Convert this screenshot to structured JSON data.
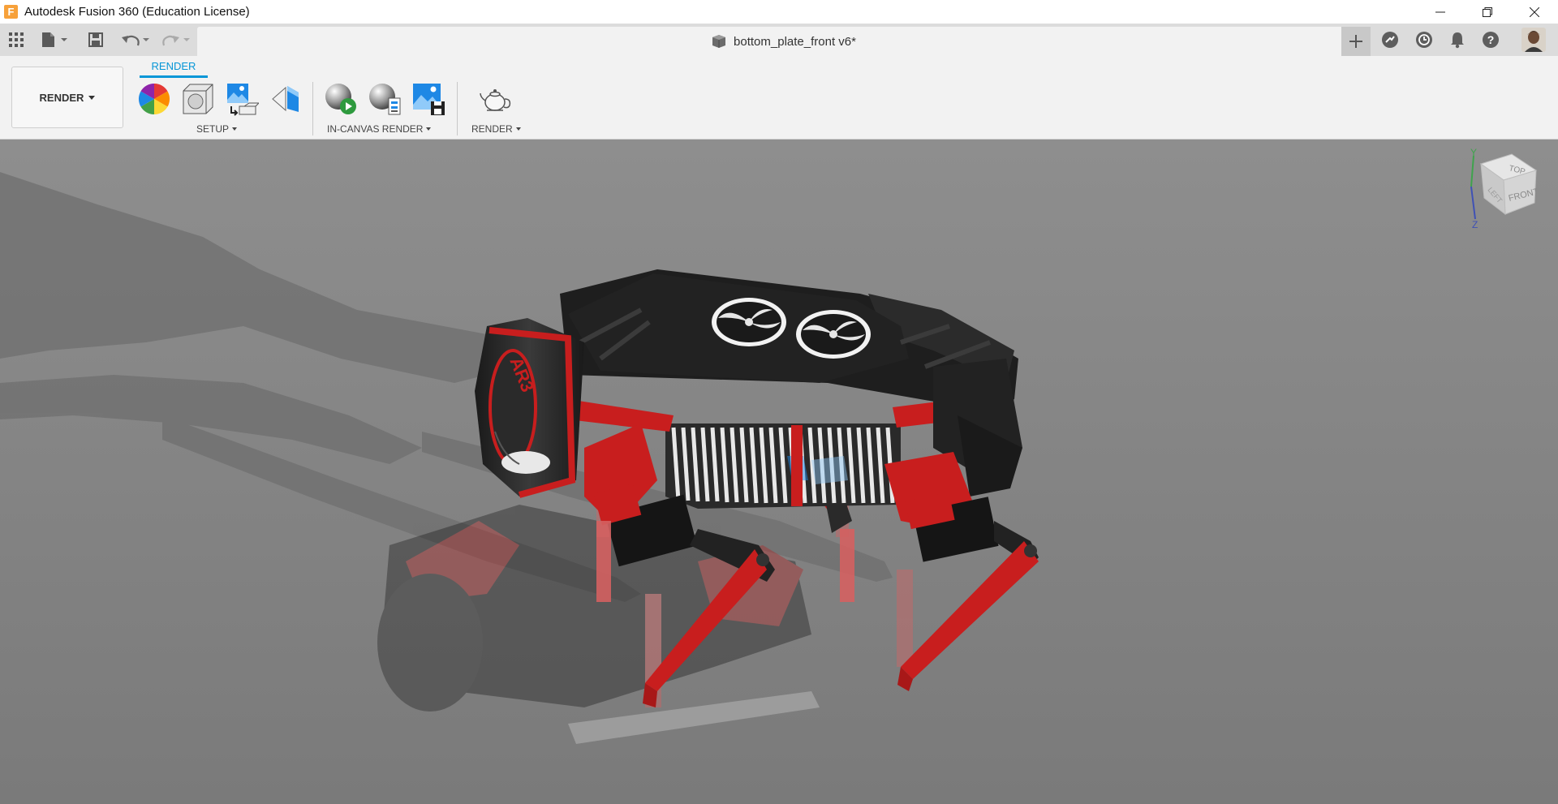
{
  "app": {
    "logo_letter": "F",
    "title": "Autodesk Fusion 360 (Education License)"
  },
  "window_controls": [
    "minimize-icon",
    "restore-icon",
    "close-icon"
  ],
  "document_tab": {
    "title": "bottom_plate_front v6*",
    "icon": "part-cube-icon"
  },
  "quick_access": [
    "grid-menu-icon",
    "file-icon",
    "save-icon",
    "undo-icon",
    "redo-icon"
  ],
  "header_right_icons": [
    "new-tab-plus-icon",
    "extensions-icon",
    "job-status-icon",
    "notifications-bell-icon",
    "help-icon",
    "user-avatar"
  ],
  "toolbar": {
    "workspace_label": "RENDER",
    "active_tab": "RENDER",
    "groups": [
      {
        "label": "SETUP",
        "tools": [
          "appearance-color-wheel-icon",
          "scene-settings-icon",
          "texture-map-icon",
          "decal-icon"
        ]
      },
      {
        "label": "IN-CANVAS RENDER",
        "tools": [
          "in-canvas-render-play-icon",
          "in-canvas-render-settings-icon",
          "capture-image-icon"
        ]
      },
      {
        "label": "RENDER",
        "tools": [
          "render-teapot-icon"
        ]
      }
    ]
  },
  "viewcube": {
    "faces": {
      "top": "TOP",
      "front": "FRONT",
      "left": "LEFT"
    },
    "axes": {
      "y": "Y",
      "z": "Z"
    }
  },
  "model": {
    "body_logo_text": "AR3"
  },
  "colors": {
    "accent": "#0696d7",
    "robot_red": "#c81e1e",
    "robot_black": "#1c1c1c",
    "canvas_gray": "#848484"
  }
}
